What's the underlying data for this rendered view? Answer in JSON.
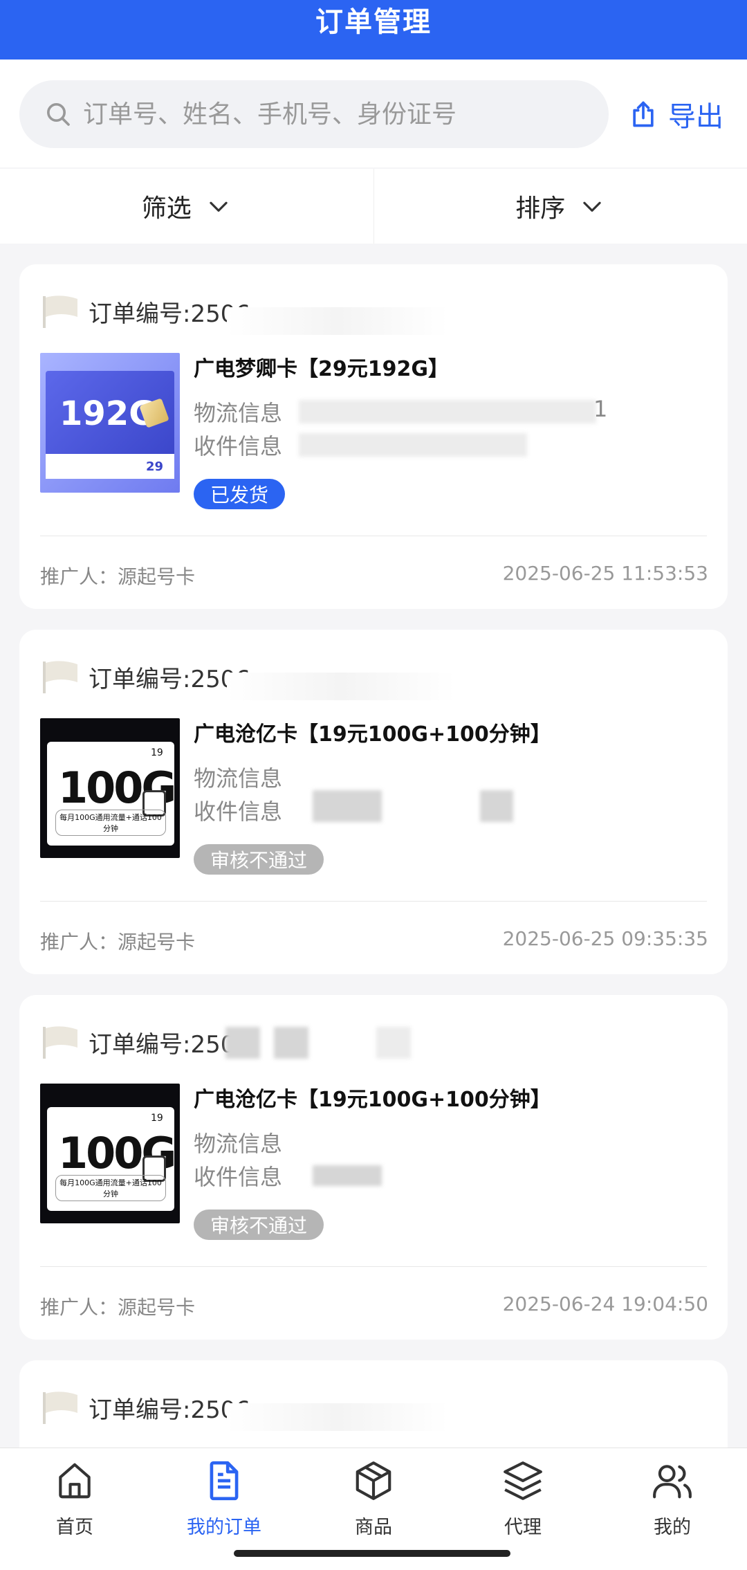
{
  "header": {
    "title": "订单管理"
  },
  "search": {
    "placeholder": "订单号、姓名、手机号、身份证号",
    "icon": "search-icon",
    "export_label": "导出",
    "export_icon": "share-icon"
  },
  "filters": [
    {
      "label": "筛选",
      "icon": "chevron-down-icon"
    },
    {
      "label": "排序",
      "icon": "chevron-down-icon"
    }
  ],
  "orders": [
    {
      "order_no_label": "订单编号:2506",
      "product_title": "广电梦卿卡【29元192G】",
      "logistics_label": "物流信息",
      "logistics_value_hint": "1",
      "recipient_label": "收件信息",
      "status": "已发货",
      "promoter": "推广人：源起号卡",
      "time": "2025-06-25 11:53:53",
      "thumb": {
        "big": "192G",
        "price": "29"
      }
    },
    {
      "order_no_label": "订单编号:2506",
      "product_title": "广电沧亿卡【19元100G+100分钟】",
      "logistics_label": "物流信息",
      "recipient_label": "收件信息",
      "status": "审核不通过",
      "promoter": "推广人：源起号卡",
      "time": "2025-06-25 09:35:35",
      "thumb": {
        "big": "100G",
        "price": "19",
        "caption": "每月100G通用流量+通话100分钟"
      }
    },
    {
      "order_no_label": "订单编号:250",
      "product_title": "广电沧亿卡【19元100G+100分钟】",
      "logistics_label": "物流信息",
      "recipient_label": "收件信息",
      "status": "审核不通过",
      "promoter": "推广人：源起号卡",
      "time": "2025-06-24 19:04:50",
      "thumb": {
        "big": "100G",
        "price": "19",
        "caption": "每月100G通用流量+通话100分钟"
      }
    },
    {
      "order_no_label": "订单编号:2506"
    }
  ],
  "tabbar": [
    {
      "label": "首页",
      "icon": "home-icon",
      "active": false
    },
    {
      "label": "我的订单",
      "icon": "document-icon",
      "active": true
    },
    {
      "label": "商品",
      "icon": "box-icon",
      "active": false
    },
    {
      "label": "代理",
      "icon": "layers-icon",
      "active": false
    },
    {
      "label": "我的",
      "icon": "users-icon",
      "active": false
    }
  ],
  "colors": {
    "primary": "#2b64f2",
    "rejected": "#b5b5b5",
    "background": "#f5f5f7"
  }
}
